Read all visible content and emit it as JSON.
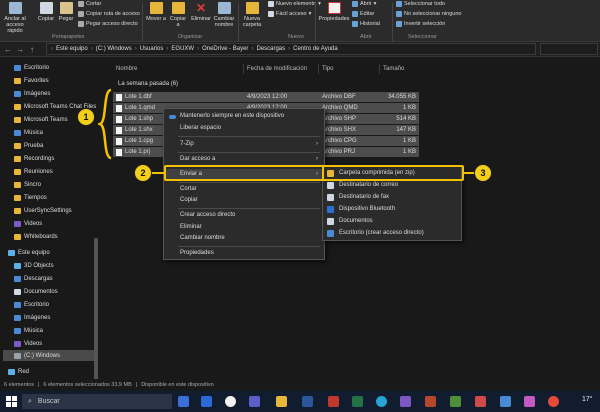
{
  "ribbon": {
    "anclar": "Anclar al acceso rápido",
    "copiar": "Copiar",
    "pegar": "Pegar",
    "cortar": "Cortar",
    "copiar_ruta": "Copiar ruta de acceso",
    "pegar_directo": "Pegar acceso directo",
    "mover_a": "Mover a",
    "copiar_a": "Copiar a",
    "eliminar": "Eliminar",
    "cambiar_nombre": "Cambiar nombre",
    "nueva_carpeta": "Nueva carpeta",
    "nuevo_elemento": "Nuevo elemento",
    "facil_acceso": "Fácil acceso",
    "propiedades": "Propiedades",
    "abrir": "Abrir",
    "editar": "Editar",
    "historial": "Historial",
    "sel_todo": "Seleccionar todo",
    "no_sel": "No seleccionar ninguno",
    "invertir": "Invertir selección",
    "groups": [
      "Portapapeles",
      "Organizar",
      "Nuevo",
      "Abrir",
      "Seleccionar"
    ]
  },
  "address": {
    "nav": [
      "←",
      "→",
      "↑"
    ],
    "crumbs": [
      "Este equipo",
      "(C:) Windows",
      "Usuarios",
      "EGUXW",
      "OneDrive - Bayer",
      "Descargas",
      "Centro de Ayuda"
    ]
  },
  "sidebar": {
    "items": [
      "Escritorio",
      "Favorites",
      "Imágenes",
      "Microsoft Teams Chat Files",
      "Microsoft Teams",
      "Música",
      "Prueba",
      "Recordings",
      "Reuniones",
      "Sincro",
      "Tiempos",
      "UserSyncSettings",
      "Videos",
      "Whiteboards",
      "Este equipo",
      "3D Objects",
      "Descargas",
      "Documentos",
      "Escritorio",
      "Imágenes",
      "Música",
      "Videos",
      "(C:) Windows",
      "Red"
    ]
  },
  "columns": [
    "Nombre",
    "Fecha de modificación",
    "Tipo",
    "Tamaño"
  ],
  "group_header": "La semana pasada (6)",
  "files": [
    {
      "name": "Lote 1.dbf",
      "date": "4/9/2023 12:00",
      "type": "Archivo DBF",
      "size": "34.055 KB"
    },
    {
      "name": "Lote 1.qmd",
      "date": "4/9/2023 12:00",
      "type": "Archivo QMD",
      "size": "1 KB"
    },
    {
      "name": "Lote 1.shp",
      "date": "",
      "type": "Archivo SHP",
      "size": "514 KB"
    },
    {
      "name": "Lote 1.shx",
      "date": "",
      "type": "Archivo SHX",
      "size": "147 KB"
    },
    {
      "name": "Lote 1.cpg",
      "date": "",
      "type": "Archivo CPG",
      "size": "1 KB"
    },
    {
      "name": "Lote 1.prj",
      "date": "",
      "type": "Archivo PRJ",
      "size": "1 KB"
    }
  ],
  "context_menu": {
    "items": [
      "Mantenerlo siempre en este dispositivo",
      "Liberar espacio",
      "7-Zip",
      "Dar acceso a",
      "Enviar a",
      "Cortar",
      "Copiar",
      "Crear acceso directo",
      "Eliminar",
      "Cambiar nombre",
      "Propiedades"
    ]
  },
  "submenu": {
    "items": [
      "Carpeta comprimida (en zip)",
      "Destinatario de correo",
      "Destinatario de fax",
      "Dispositivo Bluetooth",
      "Documentos",
      "Escritorio (crear acceso directo)"
    ]
  },
  "callouts": [
    "1",
    "2",
    "3"
  ],
  "status": {
    "count": "6 elementos",
    "selected": "6 elementos seleccionados 33,9 MB",
    "avail": "Disponible en este dispositivo"
  },
  "taskbar": {
    "search": "Buscar",
    "temp": "17°"
  },
  "colors": {
    "accent": "#f2c200",
    "folder": "#e8b53b",
    "taskbar": "#111c2e"
  }
}
